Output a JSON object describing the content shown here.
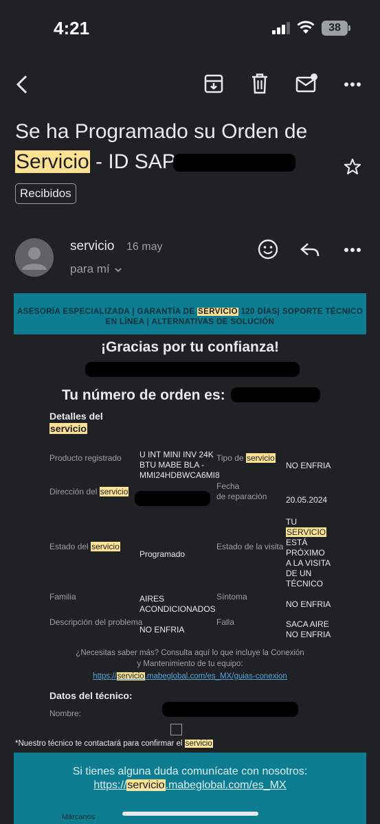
{
  "status_bar": {
    "time": "4:21",
    "battery": "38"
  },
  "email": {
    "subject_line1": "Se ha Programado su Orden de",
    "subject_hl": "Servicio",
    "subject_line2_rest": " - ID SAP",
    "label": "Recibidos",
    "sender": "servicio",
    "date": "16 may",
    "to": "para mí"
  },
  "banner": {
    "part1": "ASESORÍA ESPECIALIZADA | GARANTÍA DE ",
    "hl": "SERVICIO",
    "part2": " 120 DÍAS| SOPORTE TÉCNICO",
    "line2": "EN LÍNEA | ALTERNATIVAS DE SOLUCIÓN"
  },
  "body": {
    "thanks": "¡Gracias por tu confianza!",
    "order_label": "Tu número de orden es:",
    "details_label": "Detalles del",
    "details_hl": "servicio"
  },
  "details": {
    "product_label": "Producto registrado",
    "product_value": [
      "U INT MINI INV 24K",
      "BTU MABE BLA -",
      "MMI24HDBWCA6MI8"
    ],
    "service_type_label": "Tipo de",
    "service_type_hl": "servicio",
    "service_type_value": "NO ENFRIA",
    "address_label": "Dirección del",
    "address_hl": "servicio",
    "repair_date_label": [
      "Fecha",
      "de reparación"
    ],
    "repair_date_value": "20.05.2024",
    "state_label": "Estado del",
    "state_hl": "servicio",
    "state_value": "Programado",
    "visit_state_label": "Estado de la visita",
    "visit_state_line1": "TU",
    "visit_state_hl": "SERVICIO",
    "visit_state_rest": [
      "ESTÁ",
      "PRÓXIMO",
      "A LA VISITA",
      "DE UN",
      "TÉCNICO"
    ],
    "family_label": "Familia",
    "family_value": [
      "AIRES",
      "ACONDICIONADOS"
    ],
    "symptom_label": "Síntoma",
    "symptom_value": "NO ENFRIA",
    "problem_label": "Descripción del problema",
    "problem_value": "NO ENFRIA",
    "failure_label": "Falla",
    "failure_value": [
      "SACA AIRE",
      "NO ENFRIA"
    ]
  },
  "info": {
    "line1": "¿Necesitas saber más? Consulta aquí lo que incluye la Conexión",
    "line2": "y Mantenimiento de tu equipo:",
    "link_pre": "https://",
    "link_hl": "servicio",
    "link_post": ".mabeglobal.com/es_MX/guias-conexion"
  },
  "technician": {
    "title": "Datos del técnico:",
    "name_label": "Nombre:",
    "note_pre": "*Nuestro técnico te contactará para confirmar el ",
    "note_hl": "servicio"
  },
  "footer": {
    "text": "Si tienes alguna duda comunícate con nosotros:",
    "link_pre": "https://",
    "link_hl": "servicio",
    "link_post": ".mabeglobal.com/es_MX",
    "small": "Márcanos"
  }
}
